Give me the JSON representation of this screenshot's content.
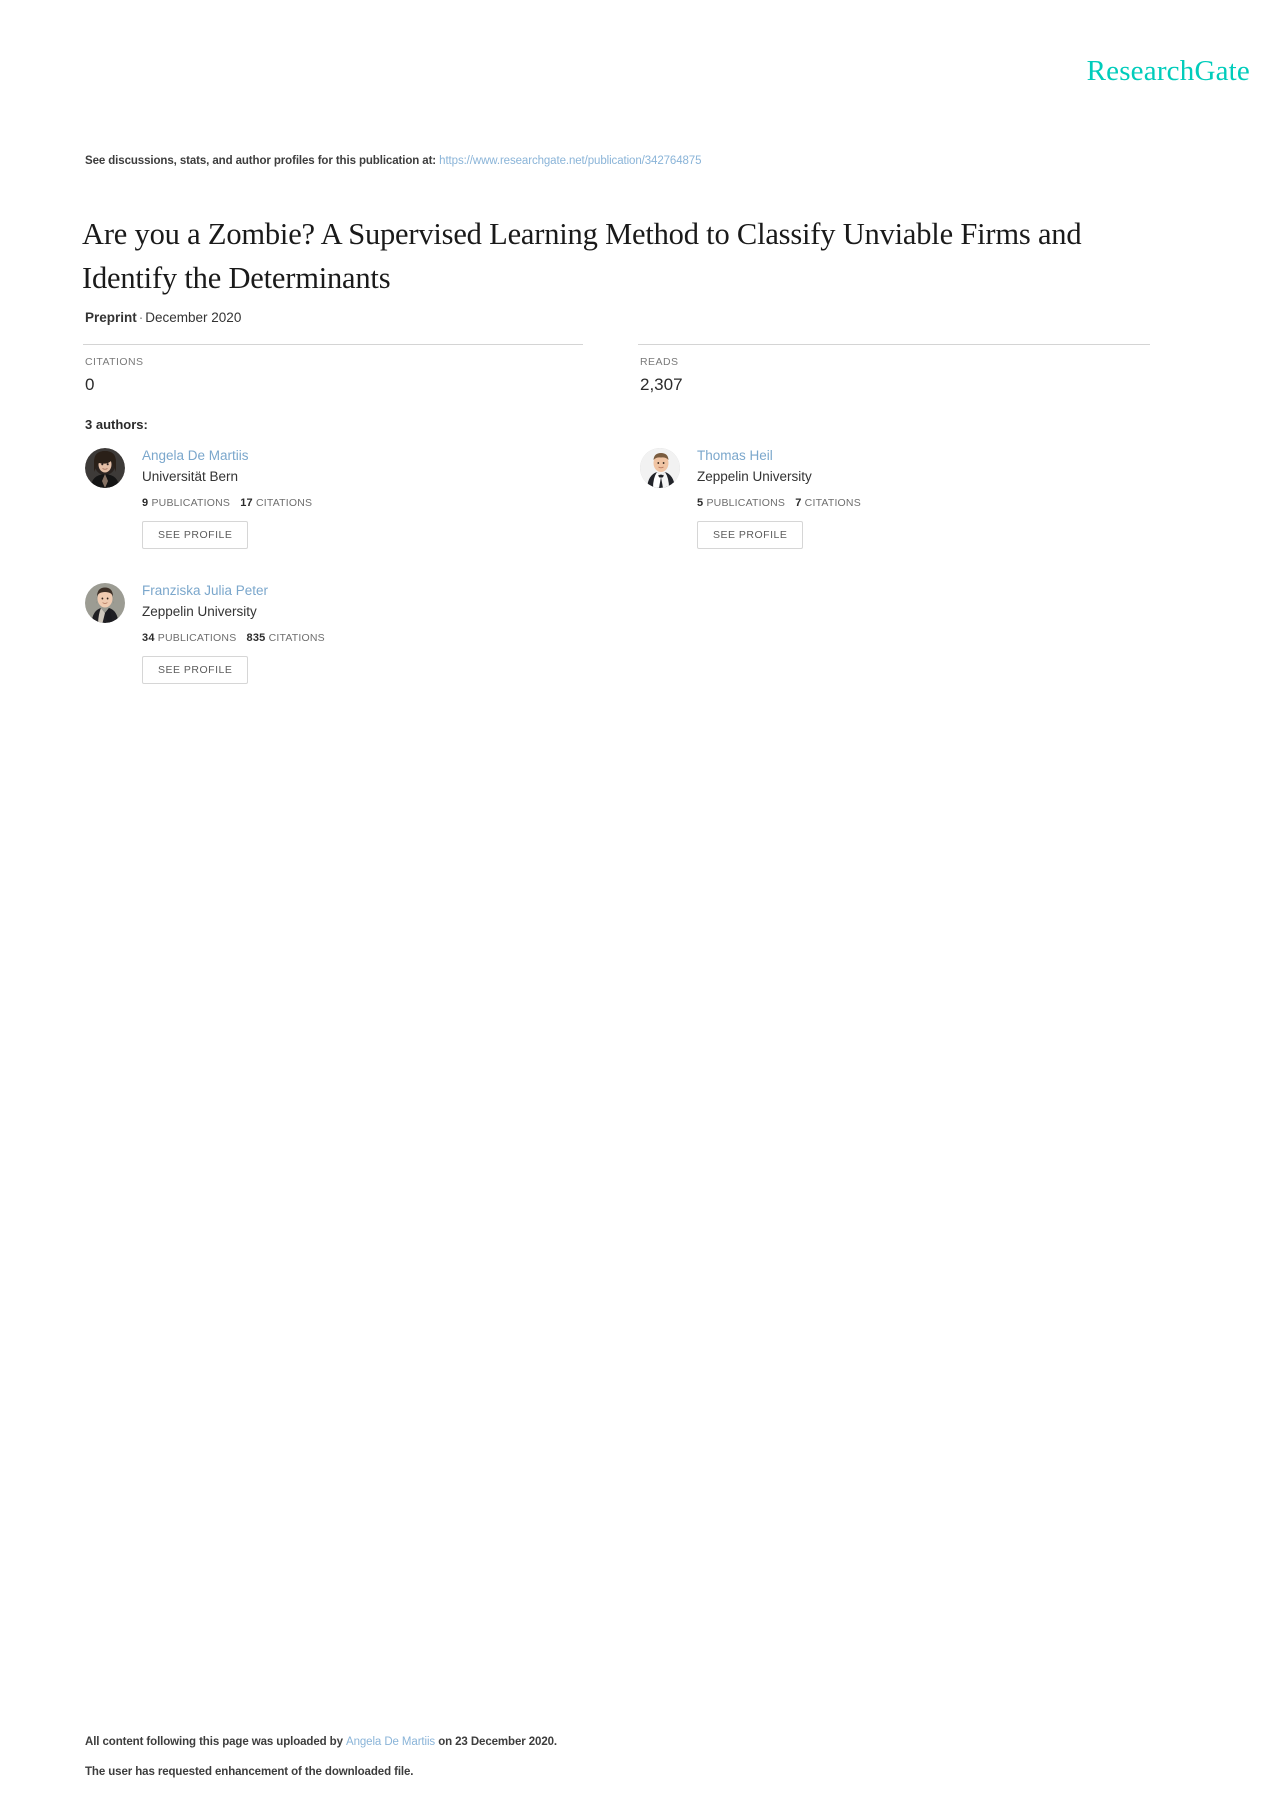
{
  "brand": {
    "logo_text": "ResearchGate",
    "logo_color": "#00ccbb"
  },
  "header": {
    "discussions_prefix": "See discussions, stats, and author profiles for this publication at:",
    "publication_url": "https://www.researchgate.net/publication/342764875"
  },
  "publication": {
    "title": "Are you a Zombie? A Supervised Learning Method to Classify Unviable Firms and Identify the Determinants",
    "type": "Preprint",
    "separator": "·",
    "date": "December 2020"
  },
  "metrics": {
    "citations": {
      "label": "CITATIONS",
      "value": "0"
    },
    "reads": {
      "label": "READS",
      "value": "2,307"
    }
  },
  "authors_section": {
    "heading": "3 authors:",
    "see_profile_label": "SEE PROFILE",
    "publications_label": "PUBLICATIONS",
    "citations_label": "CITATIONS",
    "authors": [
      {
        "name": "Angela De Martiis",
        "affiliation": "Universität Bern",
        "publications": "9",
        "citations": "17",
        "avatar": "avatar-woman-dark-hair"
      },
      {
        "name": "Thomas Heil",
        "affiliation": "Zeppelin University",
        "publications": "5",
        "citations": "7",
        "avatar": "avatar-man-tuxedo"
      },
      {
        "name": "Franziska Julia Peter",
        "affiliation": "Zeppelin University",
        "publications": "34",
        "citations": "835",
        "avatar": "avatar-woman-short-hair"
      }
    ]
  },
  "footer": {
    "upload_prefix": "All content following this page was uploaded by",
    "upload_author": "Angela De Martiis",
    "upload_suffix": "on 23 December 2020.",
    "enhancement_note": "The user has requested enhancement of the downloaded file."
  }
}
